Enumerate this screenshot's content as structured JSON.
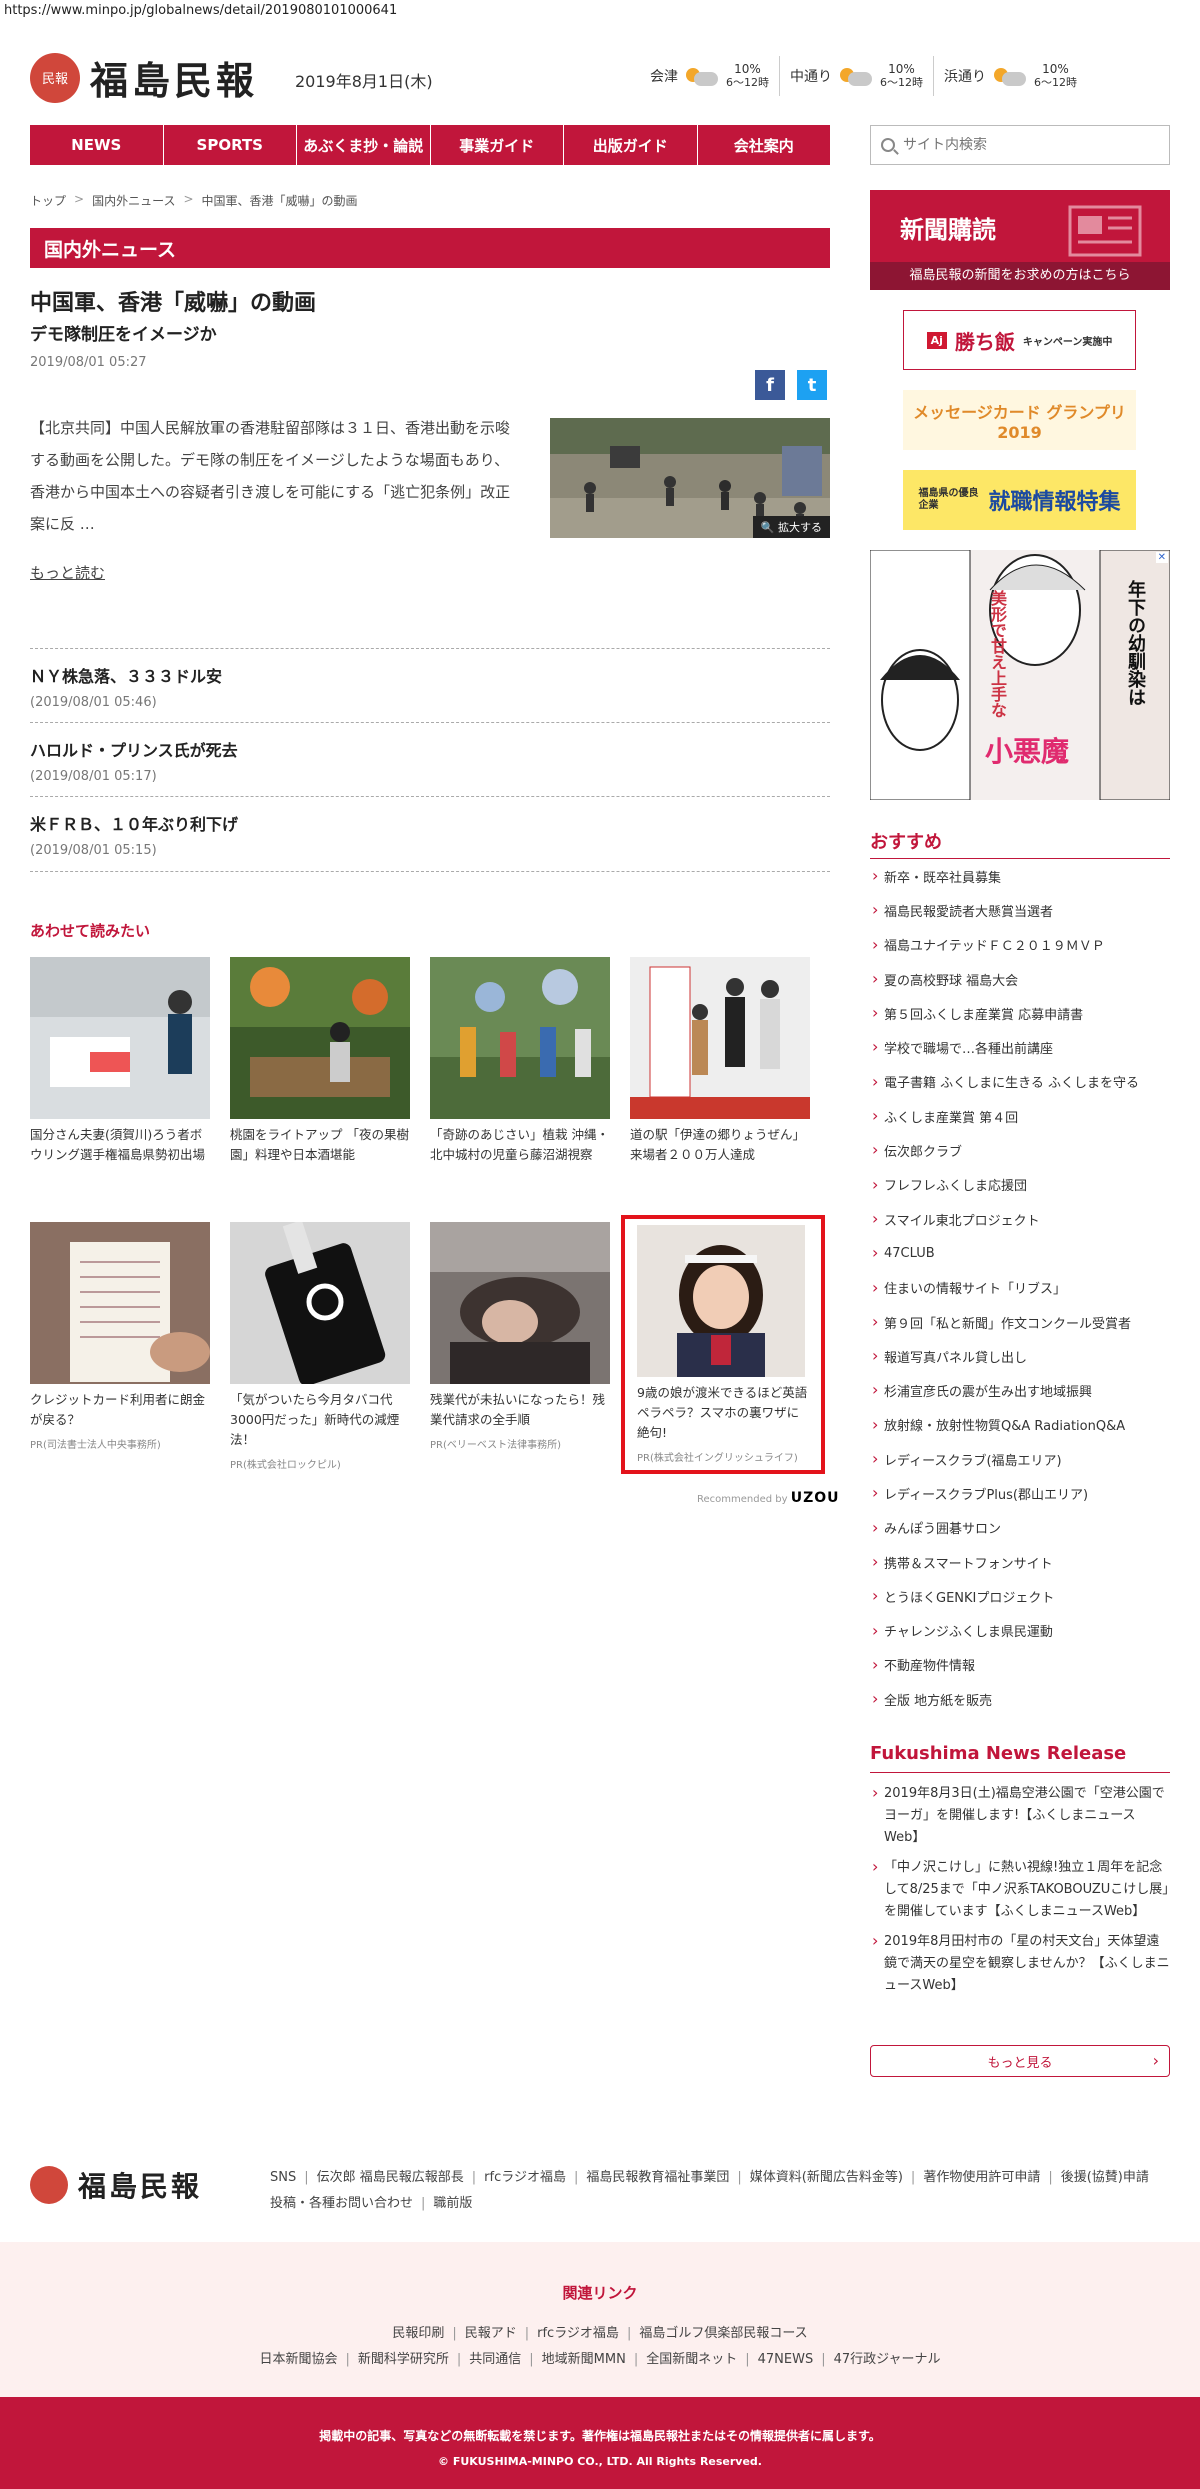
{
  "url": "https://www.minpo.jp/globalnews/detail/2019080101000641",
  "header": {
    "logo_mark": "民報",
    "logo_name": "福島民報",
    "date": "2019年8月1日(木)",
    "weather": [
      {
        "city": "会津",
        "pct": "10%",
        "time": "6〜12時",
        "icon": "sun-cloud-icon"
      },
      {
        "city": "中通り",
        "pct": "10%",
        "time": "6〜12時",
        "icon": "sun-cloud-icon"
      },
      {
        "city": "浜通り",
        "pct": "10%",
        "time": "6〜12時",
        "icon": "sun-cloud-icon"
      }
    ]
  },
  "nav": [
    "NEWS",
    "SPORTS",
    "あぶくま抄・論説",
    "事業ガイド",
    "出版ガイド",
    "会社案内"
  ],
  "search": {
    "placeholder": "サイト内検索"
  },
  "breadcrumb": [
    "トップ",
    "国内外ニュース",
    "中国軍、香港「威嚇」の動画"
  ],
  "section_title": "国内外ニュース",
  "article": {
    "title": "中国軍、香港「威嚇」の動画",
    "subtitle": "デモ隊制圧をイメージか",
    "date": "2019/08/01 05:27",
    "lead": "【北京共同】中国人民解放軍の香港駐留部隊は３１日、香港出動を示唆する動画を公開した。デモ隊の制圧をイメージしたような場面もあり、香港から中国本土への容疑者引き渡しを可能にする「逃亡犯条例」改正案に反 …",
    "zoom_label": "拡大する",
    "more_label": "もっと読む",
    "share": {
      "facebook": "f",
      "twitter": "t"
    }
  },
  "news_list": [
    {
      "title": "ＮＹ株急落、３３３ドル安",
      "date": "(2019/08/01 05:46)"
    },
    {
      "title": "ハロルド・プリンス氏が死去",
      "date": "(2019/08/01 05:17)"
    },
    {
      "title": "米ＦＲＢ、１０年ぶり利下げ",
      "date": "(2019/08/01 05:15)"
    }
  ],
  "related": {
    "heading": "あわせて読みたい",
    "cards": [
      {
        "caption": "国分さん夫妻(須賀川)ろう者ボウリング選手権福島県勢初出場",
        "pr": ""
      },
      {
        "caption": "桃園をライトアップ 「夜の果樹園」料理や日本酒堪能",
        "pr": ""
      },
      {
        "caption": "「奇跡のあじさい」植栽 沖縄・北中城村の児童ら藤沼湖視察",
        "pr": ""
      },
      {
        "caption": "道の駅「伊達の郷りょうぜん」 来場者２００万人達成",
        "pr": ""
      },
      {
        "caption": "クレジットカード利用者に朗金が戻る？",
        "pr": "PR(司法書士法人中央事務所)"
      },
      {
        "caption": "「気がついたら今月タバコ代3000円だった」新時代の減煙法！",
        "pr": "PR(株式会社ロックピル)"
      },
      {
        "caption": "残業代が未払いになったら！残業代請求の全手順",
        "pr": "PR(ベリーベスト法律事務所)"
      },
      {
        "caption": "9歳の娘が渡米できるほど英語ペラペラ？スマホの裏ワザに絶句!",
        "pr": "PR(株式会社イングリッシュライフ)"
      }
    ],
    "recommended_by": "Recommended by",
    "recommended_brand": "UZOU"
  },
  "sidebar": {
    "subscribe_title": "新聞購読",
    "subscribe_sub": "福島民報の新聞をお求めの方はこちら",
    "banners": [
      {
        "text": "勝ち飯",
        "sub": "キャンペーン実施中"
      },
      {
        "text": "メッセージカード グランプリ2019",
        "sub": ""
      },
      {
        "text": "就職情報特集",
        "sub": "福島県の優良企業"
      }
    ],
    "ad_text_1": "美形で甘え上手な",
    "ad_text_2": "小悪魔",
    "ad_text_3": "年下の幼馴染は",
    "osusume_heading": "おすすめ",
    "osusume": [
      "新卒・既卒社員募集",
      "福島民報愛読者大懸賞当選者",
      "福島ユナイテッドＦＣ２０１９ＭＶＰ",
      "夏の高校野球 福島大会",
      "第５回ふくしま産業賞 応募申請書",
      "学校で職場で…各種出前講座",
      "電子書籍 ふくしまに生きる ふくしまを守る",
      "ふくしま産業賞 第４回",
      "伝次郎クラブ",
      "フレフレふくしま応援団",
      "スマイル東北プロジェクト",
      "47CLUB",
      "住まいの情報サイト「リブス」",
      "第９回「私と新聞」作文コンクール受賞者",
      "報道写真パネル貸し出し",
      "杉浦宣彦氏の震が生み出す地域振興",
      "放射線・放射性物質Q&A RadiationQ&A",
      "レディースクラブ(福島エリア)",
      "レディースクラブPlus(郡山エリア)",
      "みんぽう囲碁サロン",
      "携帯＆スマートフォンサイト",
      "とうほくGENKIプロジェクト",
      "チャレンジふくしま県民運動",
      "不動産物件情報",
      "全版 地方紙を販売"
    ],
    "news_release_heading": "Fukushima News Release",
    "news_release": [
      "2019年8月3日(土)福島空港公園で「空港公園でヨーガ」を開催します!【ふくしまニュースWeb】",
      "「中ノ沢こけし」に熱い視線!独立１周年を記念して8/25まで「中ノ沢系TAKOBOUZUこけし展」を開催しています【ふくしまニュースWeb】",
      "2019年8月田村市の「星の村天文台」天体望遠鏡で満天の星空を観察しませんか？【ふくしまニュースWeb】"
    ],
    "more_button": "もっと見る"
  },
  "footer": {
    "logo_name": "福島民報",
    "links_row1": [
      "SNS",
      "伝次郎 福島民報広報部長",
      "rfcラジオ福島",
      "福島民報教育福祉事業団",
      "媒体資料(新聞広告料金等)",
      "著作物使用許可申請",
      "後援(協賛)申請"
    ],
    "links_row2": [
      "投稿・各種お問い合わせ",
      "職前版"
    ],
    "related_heading": "関連リンク",
    "related_row1": [
      "民報印刷",
      "民報アド",
      "rfcラジオ福島",
      "福島ゴルフ倶楽部民報コース"
    ],
    "related_row2": [
      "日本新聞協会",
      "新聞科学研究所",
      "共同通信",
      "地域新聞MMN",
      "全国新聞ネット",
      "47NEWS",
      "47行政ジャーナル"
    ],
    "notice": "掲載中の記事、写真などの無断転載を禁じます。著作権は福島民報社またはその情報提供者に属します。",
    "copyright": "© FUKUSHIMA-MINPO CO., LTD. All Rights Reserved."
  },
  "colors": {
    "brand": "#c1163b",
    "logo": "#d0473b",
    "highlight": "#e3131b"
  }
}
